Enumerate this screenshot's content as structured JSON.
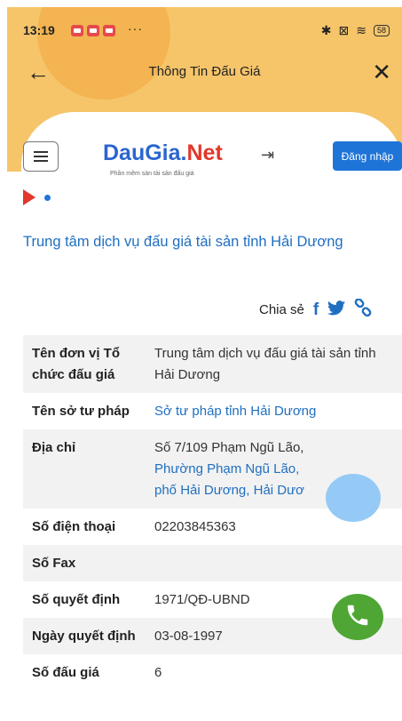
{
  "status_bar": {
    "time": "13:19",
    "dots": "···",
    "battery": "58"
  },
  "titlebar": {
    "title": "Thông Tin Đấu Giá"
  },
  "site": {
    "logo_dau": "Dau",
    "logo_gia": "Gia.",
    "logo_net": "Net",
    "tagline": "Phần mềm sàn tài sản đấu giá",
    "login_label": "Đăng nhập"
  },
  "page": {
    "title": "Trung tâm dịch vụ đấu giá tài sản tỉnh Hải Dương",
    "share_label": "Chia sẻ"
  },
  "details": {
    "org_label": "Tên đơn vị Tổ chức đấu giá",
    "org_value": "Trung tâm dịch vụ đấu giá tài sản tỉnh Hải Dương",
    "dept_label": "Tên sở tư pháp",
    "dept_value": "Sở tư pháp tỉnh Hải Dương",
    "address_label": "Địa chỉ",
    "address_street": "Số 7/109 Phạm Ngũ Lão,",
    "address_ward": "Phường Phạm Ngũ Lão,",
    "address_city": "phố Hải Dương,",
    "address_province": "Hải Dươ",
    "phone_label": "Số điện thoại",
    "phone_value": "02203845363",
    "fax_label": "Số Fax",
    "fax_value": "",
    "decision_label": "Số quyết định",
    "decision_value": "1971/QĐ-UBND",
    "decision_date_label": "Ngày quyết định",
    "decision_date_value": "03-08-1997",
    "auction_count_label": "Số đấu giá",
    "auction_count_value": "6"
  },
  "colors": {
    "header": "#f6c56a",
    "brand_blue": "#1f74d8",
    "brand_red": "#e2372a",
    "call_green": "#4fa634"
  },
  "icons": [
    "back-arrow-icon",
    "close-icon",
    "menu-icon",
    "login-icon",
    "facebook-icon",
    "twitter-icon",
    "link-icon",
    "phone-icon"
  ]
}
